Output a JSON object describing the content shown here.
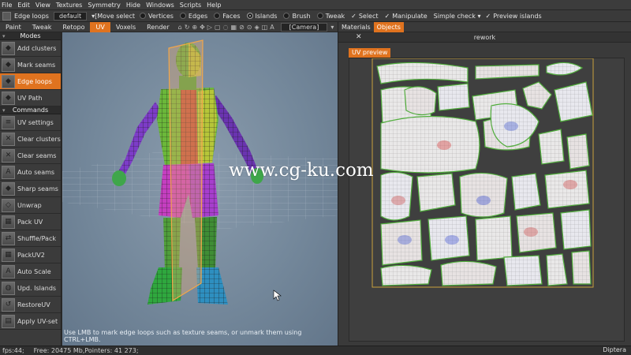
{
  "menu": [
    "File",
    "Edit",
    "View",
    "Textures",
    "Symmetry",
    "Hide",
    "Windows",
    "Scripts",
    "Help"
  ],
  "toolbar": {
    "tool_name": "Edge loops",
    "preset_value": "default",
    "mode_value": "[Move select",
    "radios": [
      {
        "label": "Vertices",
        "on": false
      },
      {
        "label": "Edges",
        "on": false
      },
      {
        "label": "Faces",
        "on": false
      },
      {
        "label": "Islands",
        "on": true
      },
      {
        "label": "Brush",
        "on": false
      },
      {
        "label": "Tweak",
        "on": false
      }
    ],
    "checks": [
      {
        "label": "Select",
        "checked": true
      },
      {
        "label": "Manipulate",
        "checked": true
      }
    ],
    "simple_check": "Simple check",
    "preview_islands": "Preview islands"
  },
  "room_tabs": [
    "Paint",
    "Tweak",
    "Retopo",
    "UV",
    "Voxels",
    "Render"
  ],
  "active_room": "UV",
  "camera_label": "[Camera]",
  "sidebar": {
    "modes_header": "Modes",
    "modes": [
      {
        "label": "Add clusters",
        "icon": "cube-icon",
        "active": false
      },
      {
        "label": "Mark seams",
        "icon": "cube-icon",
        "active": false
      },
      {
        "label": "Edge loops",
        "icon": "cube-icon",
        "active": true
      },
      {
        "label": "UV Path",
        "icon": "cube-icon",
        "active": false
      }
    ],
    "commands_header": "Commands",
    "commands": [
      {
        "label": "UV settings",
        "icon": "settings-icon"
      },
      {
        "label": "Clear clusters",
        "icon": "clear-icon"
      },
      {
        "label": "Clear seams",
        "icon": "clear-icon"
      },
      {
        "label": "Auto seams",
        "icon": "auto-icon"
      },
      {
        "label": "Sharp seams",
        "icon": "cube-icon"
      },
      {
        "label": "Unwrap",
        "icon": "unwrap-icon"
      },
      {
        "label": "Pack UV",
        "icon": "pack-icon"
      },
      {
        "label": "Shuffle/Pack",
        "icon": "shuffle-icon"
      },
      {
        "label": "PackUV2",
        "icon": "pack-icon"
      },
      {
        "label": "Auto Scale",
        "icon": "auto-icon"
      },
      {
        "label": "Upd. Islands",
        "icon": "islands-icon"
      },
      {
        "label": "RestoreUV",
        "icon": "restore-icon"
      },
      {
        "label": "Apply UV-set",
        "icon": "apply-icon"
      }
    ]
  },
  "viewport": {
    "hint": "Use LMB to mark edge loops such as texture seams, or unmark them using CTRL+LMB."
  },
  "right_panel": {
    "tabs": [
      "Materials",
      "Objects"
    ],
    "active_tab": "Objects",
    "object_title": "rework",
    "uv_tab": "UV preview"
  },
  "status": {
    "fps": "fps:44;",
    "free": "Free: 20475 Mb,Pointers: 41 273;",
    "brand": "Diptera"
  },
  "watermark": "www.cg-ku.com",
  "colors": {
    "accent": "#e0731f",
    "uv_border": "#c8a03c",
    "uv_island": "#e8e6e6",
    "uv_edge": "#4fae3a"
  }
}
